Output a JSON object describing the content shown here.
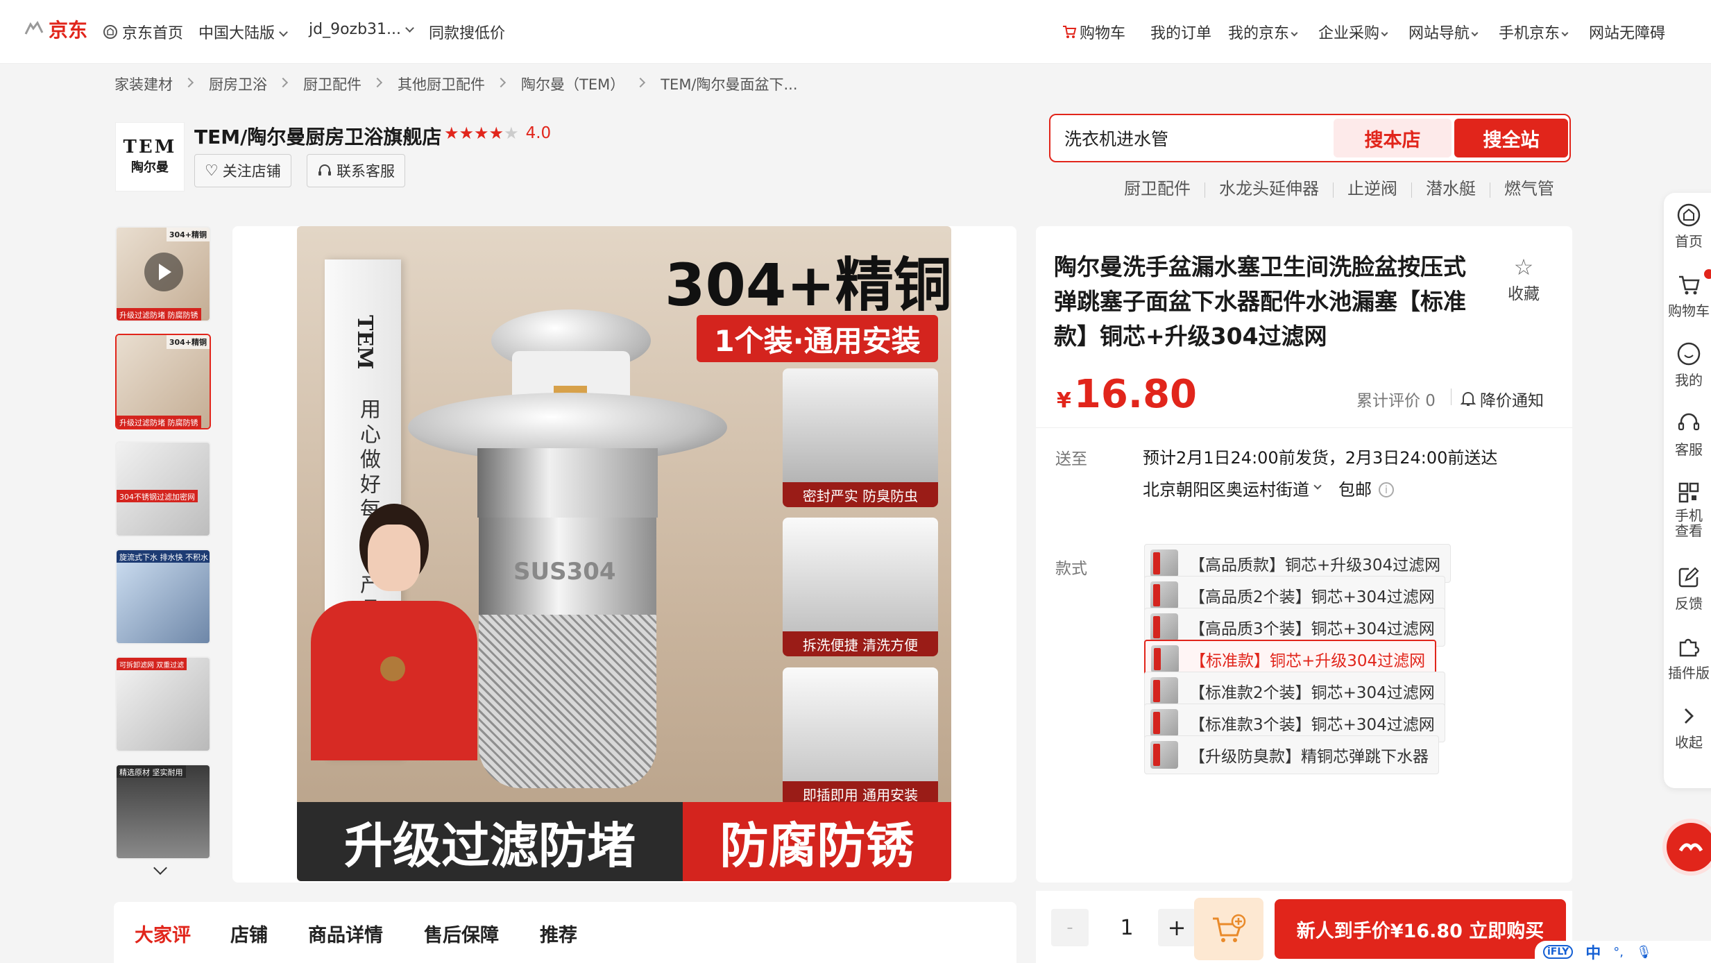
{
  "topbar": {
    "logo": "京东",
    "home": "京东首页",
    "region": "中国大陆版",
    "user": "jd_9ozb31...",
    "same_low_price": "同款搜低价",
    "cart": "购物车",
    "orders": "我的订单",
    "my_jd": "我的京东",
    "enterprise": "企业采购",
    "site_nav": "网站导航",
    "mobile_jd": "手机京东",
    "accessibility": "网站无障碍"
  },
  "breadcrumb": [
    "家装建材",
    "厨房卫浴",
    "厨卫配件",
    "其他厨卫配件",
    "陶尔曼（TEM）",
    "TEM/陶尔曼面盆下..."
  ],
  "store": {
    "logo_line1": "TEM",
    "logo_line2": "陶尔曼",
    "name": "TEM/陶尔曼厨房卫浴旗舰店",
    "rating": "4.0",
    "rating_stars": 4,
    "follow": "关注店铺",
    "service": "联系客服"
  },
  "search": {
    "value": "洗衣机进水管",
    "search_store": "搜本店",
    "search_all": "搜全站",
    "hot": [
      "厨卫配件",
      "水龙头延伸器",
      "止逆阀",
      "潜水艇",
      "燃气管"
    ]
  },
  "gallery": {
    "thumbs": [
      {
        "tag": "升级过滤防堵 防腐防锈",
        "corner": "304+精铜"
      },
      {
        "tag": "升级过滤防堵 防腐防锈",
        "corner": "304+精铜"
      },
      {
        "tag": "304不锈钢过滤加密网",
        "corner": ""
      },
      {
        "tag": "旋流式下水 排水快 不积水",
        "corner": ""
      },
      {
        "tag": "可拆卸滤网 双重过滤",
        "corner": ""
      },
      {
        "tag": "精选原材 坚实耐用",
        "corner": ""
      }
    ],
    "main": {
      "headline": "304+精铜",
      "subhead": "1个装·通用安装",
      "box_text": "用心做好每一个产品",
      "brand": "TEM",
      "product_mark": "SUS304",
      "feature1": "密封严实 防臭防虫",
      "feature2": "拆洗便捷 清洗方便",
      "feature3": "即插即用 通用安装",
      "banner_left": "升级过滤防堵",
      "banner_right": "防腐防锈"
    }
  },
  "product": {
    "title": "陶尔曼洗手盆漏水塞卫生间洗脸盆按压式弹跳塞子面盆下水器配件水池漏塞【标准款】铜芯+升级304过滤网",
    "favorite": "收藏",
    "currency": "¥",
    "price": "16.80",
    "reviews": "累计评价 0",
    "price_alert": "降价通知",
    "ship_label": "送至",
    "ship_estimate": "预计2月1日24:00前发货，2月3日24:00前送达",
    "ship_address": "北京朝阳区奥运村街道",
    "ship_fee": "包邮",
    "style_label": "款式",
    "options": [
      "【高品质款】铜芯+升级304过滤网",
      "【高品质2个装】铜芯+304过滤网",
      "【高品质3个装】铜芯+304过滤网",
      "【标准款】铜芯+升级304过滤网",
      "【标准款2个装】铜芯+304过滤网",
      "【标准款3个装】铜芯+304过滤网",
      "【升级防臭款】精铜芯弹跳下水器"
    ],
    "selected_option": 3
  },
  "buy": {
    "minus": "-",
    "quantity": "1",
    "plus": "+",
    "buy_now": "新人到手价¥16.80 立即购买"
  },
  "tabs": [
    "大家评",
    "店铺",
    "商品详情",
    "售后保障",
    "推荐"
  ],
  "sidebar": {
    "home": "首页",
    "cart": "购物车",
    "mine": "我的",
    "service": "客服",
    "mobile_view": "手机查看",
    "feedback": "反馈",
    "plugin": "插件版",
    "collapse": "收起"
  },
  "ime": {
    "zh": "中"
  },
  "colors": {
    "accent": "#e1251b",
    "accent_light": "#fdeaea"
  }
}
